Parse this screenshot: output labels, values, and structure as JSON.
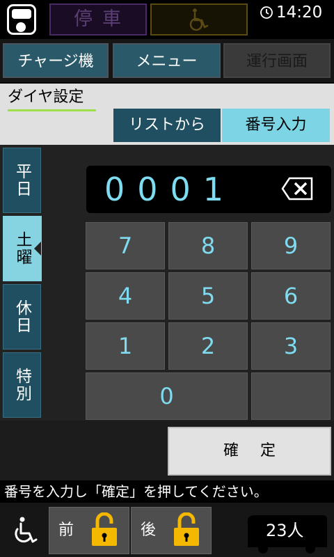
{
  "status": {
    "stop_label": "停車",
    "time": "14:20",
    "icons": [
      "phone-icon",
      "wheelchair-icon",
      "clock-icon"
    ]
  },
  "nav": {
    "charger": "チャージ機",
    "menu": "メニュー",
    "run_screen": "運行画面"
  },
  "dia": {
    "title": "ダイヤ設定",
    "tab_list": "リストから",
    "tab_number": "番号入力"
  },
  "day_tabs": [
    {
      "label": "平日",
      "selected": false
    },
    {
      "label": "土曜",
      "selected": true
    },
    {
      "label": "休日",
      "selected": false
    },
    {
      "label": "特別",
      "selected": false
    }
  ],
  "keypad": {
    "display_value": "0001",
    "keys": [
      "7",
      "8",
      "9",
      "4",
      "5",
      "6",
      "1",
      "2",
      "3",
      "0"
    ]
  },
  "confirm_label": "確 定",
  "message": "番号を入力し「確定」を押してください。",
  "bottom": {
    "front_door": "前",
    "rear_door": "後",
    "passengers": "23人"
  },
  "colors": {
    "accent": "#7fdcf0",
    "tab_active": "#86d4e2",
    "tab_inactive": "#1f4f60",
    "lock": "#f5b800",
    "underline": "#9fe04a"
  }
}
